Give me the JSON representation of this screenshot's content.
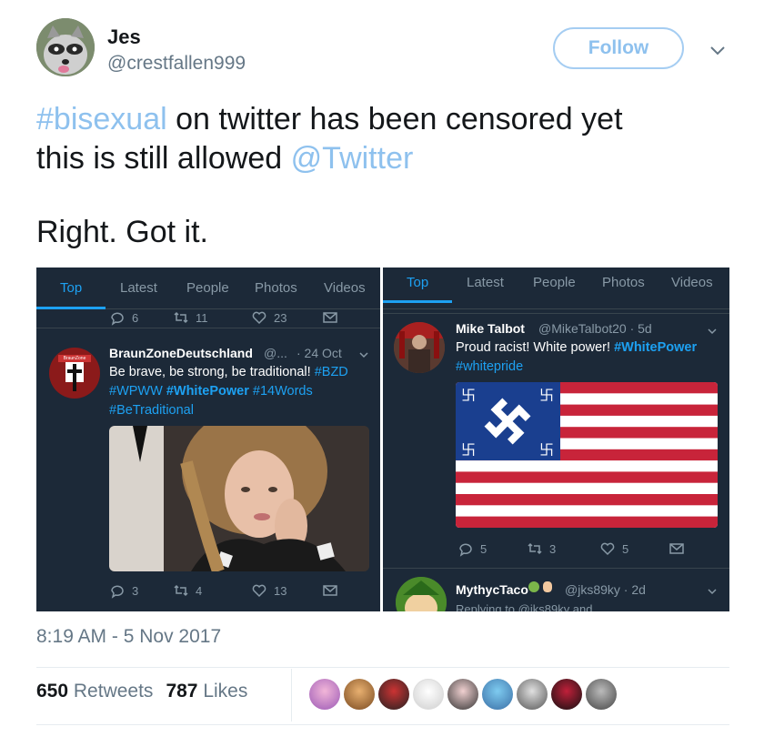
{
  "user": {
    "name": "Jes",
    "handle": "@crestfallen999",
    "follow_label": "Follow"
  },
  "tweet": {
    "line1_tag": "#bisexual",
    "line1_rest": " on twitter has been censored yet",
    "line2_text": "this is still allowed ",
    "line2_mention": "@Twitter",
    "line3": "Right. Got it."
  },
  "left_shot": {
    "tabs": [
      "Top",
      "Latest",
      "People",
      "Photos",
      "Videos"
    ],
    "prev_actions": {
      "replies": "6",
      "retweets": "11",
      "likes": "23"
    },
    "post": {
      "name": "BraunZoneDeutschland",
      "handle": "@...",
      "time": "· 24 Oct",
      "body_line1": "Be brave, be strong, be traditional! ",
      "tag_bzd": "#BZD",
      "tag_wpww": "#WPWW",
      "tag_whitepower": "#WhitePower",
      "tag_14words": "#14Words",
      "tag_betraditional": "#BeTraditional",
      "avatar_label": "BraunZone",
      "actions": {
        "replies": "3",
        "retweets": "4",
        "likes": "13"
      }
    }
  },
  "right_shot": {
    "tabs": [
      "Top",
      "Latest",
      "People",
      "Photos",
      "Videos"
    ],
    "post": {
      "name": "Mike Talbot",
      "handle": "@MikeTalbot20 · 5d",
      "body_line1": "Proud racist! White power! ",
      "tag_whitepower": "#WhitePower",
      "tag_whitepride": "#whitepride",
      "actions": {
        "replies": "5",
        "retweets": "3",
        "likes": "5"
      }
    },
    "next_post": {
      "name": "MythycTaco",
      "handle": "@jks89ky · 2d",
      "replying": "Replying to @jks89ky and"
    }
  },
  "footer": {
    "timestamp": "8:19 AM - 5 Nov 2017",
    "retweets_count": "650",
    "retweets_label": "Retweets",
    "likes_count": "787",
    "likes_label": "Likes"
  },
  "colors": {
    "link": "#8ec1ee",
    "dark_bg": "#1c2938",
    "twitter_blue": "#1da1f2"
  }
}
